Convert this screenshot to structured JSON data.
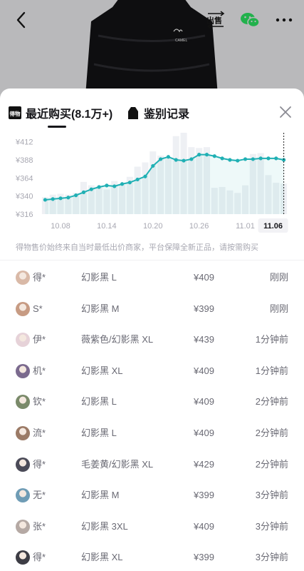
{
  "header": {
    "sell_icon_text": "出售"
  },
  "hero": {
    "logo_text": "CAMEL"
  },
  "tabs": [
    {
      "label": "最近购买(8.1万+)",
      "icon_text": "得物",
      "active": true
    },
    {
      "label": "鉴别记录",
      "active": false
    }
  ],
  "notice": "得物售价始终来自当时最低出价商家，平台保障全新正品，请按需购买",
  "chart_data": {
    "type": "line",
    "x": [
      "10.06",
      "10.07",
      "10.08",
      "10.09",
      "10.10",
      "10.11",
      "10.12",
      "10.13",
      "10.14",
      "10.15",
      "10.16",
      "10.17",
      "10.18",
      "10.19",
      "10.20",
      "10.21",
      "10.22",
      "10.23",
      "10.24",
      "10.25",
      "10.26",
      "10.27",
      "10.28",
      "10.29",
      "10.30",
      "10.31",
      "11.01",
      "11.02",
      "11.03",
      "11.04",
      "11.05",
      "11.06"
    ],
    "price_series": {
      "values": [
        335,
        336,
        337,
        338,
        341,
        345,
        349,
        352,
        354,
        353,
        356,
        358,
        362,
        366,
        380,
        389,
        392,
        388,
        387,
        389,
        395,
        395,
        393,
        390,
        388,
        387,
        389,
        389,
        390,
        390,
        390,
        388
      ]
    },
    "volume_series": {
      "values": [
        20,
        23,
        24,
        23,
        25,
        38,
        34,
        33,
        29,
        39,
        35,
        44,
        56,
        61,
        74,
        69,
        65,
        92,
        96,
        79,
        78,
        79,
        31,
        32,
        28,
        25,
        34,
        71,
        72,
        46,
        37,
        36
      ]
    },
    "x_ticks": [
      "10.08",
      "10.14",
      "10.20",
      "10.26",
      "11.01",
      "11.06"
    ],
    "y_ticks": [
      "¥316",
      "¥340",
      "¥364",
      "¥388",
      "¥412"
    ],
    "ylim": [
      316,
      424
    ],
    "highlighted_tick": "11.06",
    "line_color": "#20b0b4"
  },
  "purchases": [
    {
      "user": "得*",
      "spec": "幻影黑 L",
      "price": "¥409",
      "time": "刚刚",
      "avatar_color": "#d9b9a7"
    },
    {
      "user": "S*",
      "spec": "幻影黑 M",
      "price": "¥399",
      "time": "刚刚",
      "avatar_color": "#c79b83"
    },
    {
      "user": "伊*",
      "spec": "薇紫色/幻影黑 XL",
      "price": "¥439",
      "time": "1分钟前",
      "avatar_color": "#e6d2d8"
    },
    {
      "user": "机*",
      "spec": "幻影黑 XL",
      "price": "¥409",
      "time": "1分钟前",
      "avatar_color": "#7b6a8e"
    },
    {
      "user": "钦*",
      "spec": "幻影黑 L",
      "price": "¥409",
      "time": "2分钟前",
      "avatar_color": "#7a8a6a"
    },
    {
      "user": "流*",
      "spec": "幻影黑 L",
      "price": "¥409",
      "time": "2分钟前",
      "avatar_color": "#9b7a66"
    },
    {
      "user": "得*",
      "spec": "毛姜黄/幻影黑 XL",
      "price": "¥429",
      "time": "2分钟前",
      "avatar_color": "#4b4b58"
    },
    {
      "user": "无*",
      "spec": "幻影黑 M",
      "price": "¥399",
      "time": "3分钟前",
      "avatar_color": "#6f9cb5"
    },
    {
      "user": "张*",
      "spec": "幻影黑 3XL",
      "price": "¥409",
      "time": "3分钟前",
      "avatar_color": "#b5a9a4"
    },
    {
      "user": "得*",
      "spec": "幻影黑 XL",
      "price": "¥399",
      "time": "3分钟前",
      "avatar_color": "#3d3d45"
    }
  ]
}
